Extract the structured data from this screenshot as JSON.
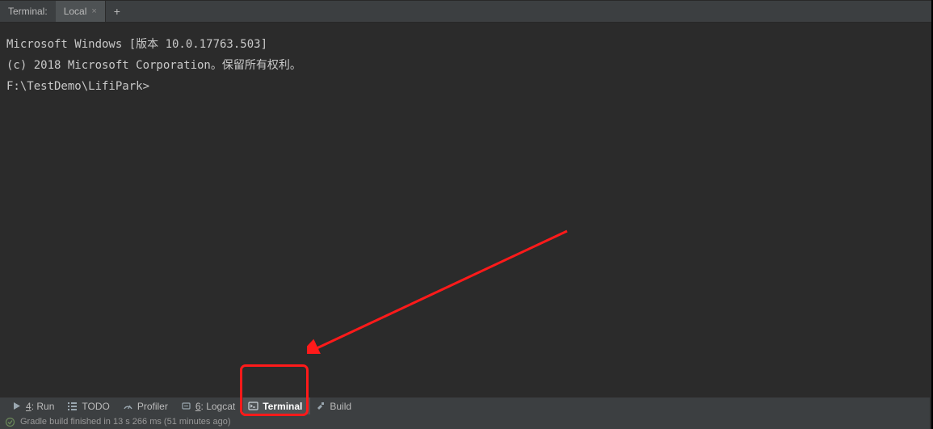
{
  "tabs": {
    "panel_label": "Terminal:",
    "active_tab": "Local",
    "close_glyph": "×",
    "add_glyph": "+"
  },
  "terminal": {
    "lines": [
      "Microsoft Windows [版本 10.0.17763.503]",
      "(c) 2018 Microsoft Corporation。保留所有权利。",
      "",
      "F:\\TestDemo\\LifiPark>"
    ]
  },
  "tools": {
    "run": {
      "num": "4",
      "label": ": Run"
    },
    "todo": {
      "label": "TODO"
    },
    "profiler": {
      "label": "Profiler"
    },
    "logcat": {
      "num": "6",
      "label": ": Logcat"
    },
    "terminal": {
      "label": "Terminal"
    },
    "build": {
      "label": "Build"
    }
  },
  "status": {
    "text": "Gradle build finished in 13 s 266 ms (51 minutes ago)"
  }
}
